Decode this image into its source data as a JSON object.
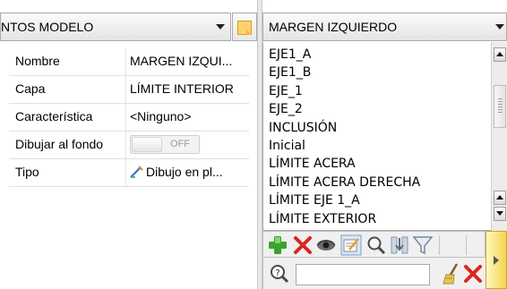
{
  "left_panel": {
    "header_title": "NTOS MODELO",
    "properties": [
      {
        "label": "Nombre",
        "value": "MARGEN IZQUI..."
      },
      {
        "label": "Capa",
        "value": "LÍMITE INTERIOR"
      },
      {
        "label": "Característica",
        "value": "<Ninguno>"
      },
      {
        "label": "Dibujar al fondo",
        "toggle": "OFF"
      },
      {
        "label": "Tipo",
        "value": "Dibujo en pl..."
      }
    ]
  },
  "right_panel": {
    "header_title": "MARGEN IZQUIERDO",
    "items": [
      "EJE1_A",
      "EJE1_B",
      "EJE_1",
      "EJE_2",
      "INCLUSIÓN",
      "Inicial",
      "LÍMITE ACERA",
      "LÍMITE ACERA DERECHA",
      "LÍMITE EJE 1_A",
      "LÍMITE EXTERIOR"
    ],
    "search": {
      "value": "",
      "placeholder": ""
    }
  },
  "icons": {
    "add": "plus-icon",
    "delete": "close-icon",
    "visibility": "eye-icon",
    "edit": "edit-icon",
    "search": "magnifier-icon",
    "filter": "funnel-icon",
    "clear": "broom-icon"
  },
  "colors": {
    "accent_green": "#3aa32b",
    "delete_red": "#d9261c",
    "toolbar_bg": "#f0f0f0",
    "header_bg": "#e4e4e4"
  }
}
